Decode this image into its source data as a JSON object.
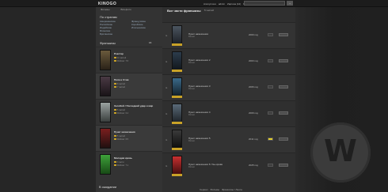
{
  "logo": "KINOGO",
  "topnav": [
    "Anonymous",
    "admin",
    "Zaprosa (12)",
    "Выход"
  ],
  "search_button": "→",
  "subnav": [
    "Фильмы",
    "Всё-фото"
  ],
  "sidebar": {
    "section_title": "По странам",
    "links_left": [
      "Американские",
      "Российские",
      "Индийские",
      "Японские",
      "Британские"
    ],
    "links_right": [
      "Французские",
      "Корейские",
      "Итальянские"
    ],
    "franchise_title": "Франшизы",
    "franchise_count": "16",
    "films": [
      {
        "name": "Рокстар",
        "meta1": "11 частей",
        "meta2": "Рейтинг: 7.5"
      },
      {
        "name": "Пила и Стив",
        "meta1": "8 частей",
        "meta2": "7 частей"
      },
      {
        "name": "Хеллбой / Последний удар и мир",
        "meta1": "5 частей",
        "meta2": "Рейтинг: 6.4"
      },
      {
        "name": "Пункт назначения",
        "meta1": "5 частей",
        "meta2": "Рейтинг: 6.5"
      },
      {
        "name": "Молодая кровь",
        "meta1": "3 части",
        "meta2": "Рейтинг: 7.1"
      }
    ],
    "bottom_title": "В ожидании"
  },
  "main": {
    "title": "Все части франшизы",
    "subtitle": "5 частей",
    "rows": [
      {
        "title": "Пункт назначения",
        "sub": "Фильм",
        "year": "2000 год",
        "rate_hl": false
      },
      {
        "title": "Пункт назначения 2",
        "sub": "Фильм",
        "year": "2003 год",
        "rate_hl": false
      },
      {
        "title": "Пункт назначения 3",
        "sub": "Фильм",
        "year": "2006 год",
        "rate_hl": false
      },
      {
        "title": "Пункт назначения 4",
        "sub": "Фильм",
        "year": "2009 год",
        "rate_hl": false
      },
      {
        "title": "Пункт назначения 5",
        "sub": "Фильм",
        "year": "2011 год",
        "rate_hl": true
      },
      {
        "title": "Пункт назначения 6: Узы крови",
        "sub": "Фильм",
        "year": "2025 год",
        "rate_hl": false
      }
    ]
  },
  "pager": [
    "Сериал",
    "Фильмы",
    "Франшизы / Лента"
  ],
  "watermark": "W",
  "colors": {
    "accent": "#c9a227",
    "highlight": "#e5d02a"
  }
}
